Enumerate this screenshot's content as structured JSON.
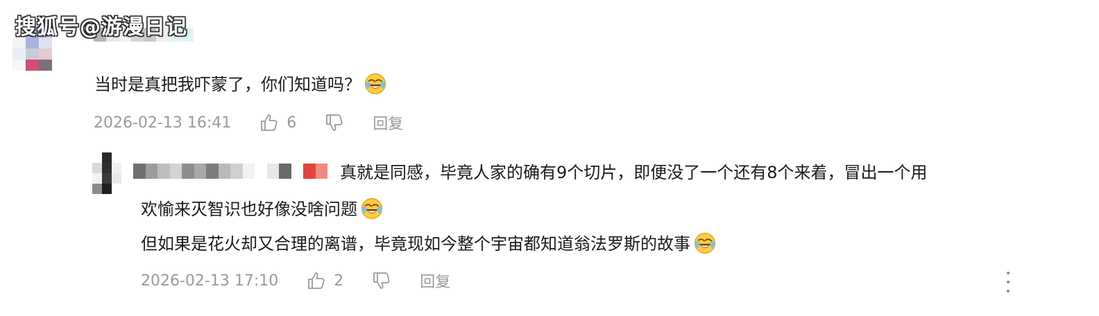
{
  "watermark": "搜狐号@游漫日记",
  "colors": {
    "text": "#1a1a1a",
    "meta": "#9a9a9a",
    "background": "#ffffff"
  },
  "comment": {
    "text": "当时是真把我吓蒙了，你们知道吗？",
    "emoji": "laughing-crying-emoji",
    "timestamp": "2026-02-13 16:41",
    "like_count": "6",
    "reply_label": "回复"
  },
  "reply": {
    "line1": "真就是同感，毕竟人家的确有9个切片，即便没了一个还有8个来着，冒出一个用",
    "line2": "欢愉来灭智识也好像没啥问题",
    "line3": "但如果是花火却又合理的离谱，毕竟现如今整个宇宙都知道翁法罗斯的故事",
    "emoji": "laughing-crying-emoji",
    "timestamp": "2026-02-13 17:10",
    "like_count": "2",
    "reply_label": "回复"
  },
  "icons": {
    "like": "thumbs-up-icon",
    "dislike": "thumbs-down-icon",
    "more": "more-vertical-icon"
  }
}
